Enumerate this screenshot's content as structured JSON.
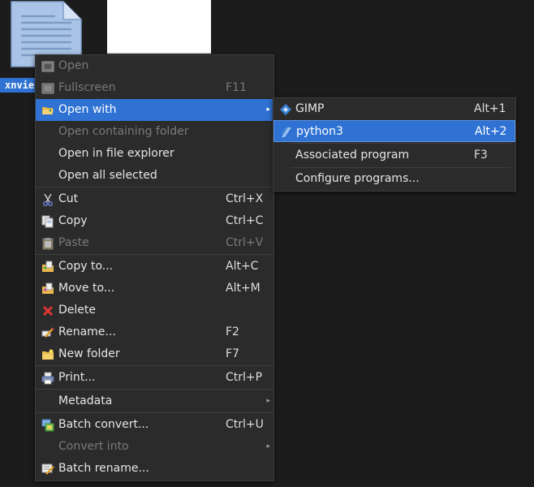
{
  "desktop": {
    "file_label": "xnvie",
    "doc_icon": "document-icon"
  },
  "colors": {
    "menu_bg": "#2b2b2b",
    "highlight": "#2f72d3",
    "disabled_text": "#7a7a7a",
    "text": "#e6e6e6"
  },
  "main_menu": {
    "open": {
      "label": "Open",
      "icon": "open-icon"
    },
    "fullscreen": {
      "label": "Fullscreen",
      "shortcut": "F11",
      "icon": "fullscreen-icon"
    },
    "open_with": {
      "label": "Open with",
      "icon": "folder-open-icon"
    },
    "open_containing": {
      "label": "Open containing folder"
    },
    "open_explorer": {
      "label": "Open in file explorer"
    },
    "open_all": {
      "label": "Open all selected"
    },
    "cut": {
      "label": "Cut",
      "shortcut": "Ctrl+X",
      "icon": "scissors-icon"
    },
    "copy": {
      "label": "Copy",
      "shortcut": "Ctrl+C",
      "icon": "copy-icon"
    },
    "paste": {
      "label": "Paste",
      "shortcut": "Ctrl+V",
      "icon": "paste-icon"
    },
    "copy_to": {
      "label": "Copy to...",
      "shortcut": "Alt+C",
      "icon": "copy-to-icon"
    },
    "move_to": {
      "label": "Move to...",
      "shortcut": "Alt+M",
      "icon": "move-to-icon"
    },
    "delete": {
      "label": "Delete",
      "icon": "delete-icon"
    },
    "rename": {
      "label": "Rename...",
      "shortcut": "F2",
      "icon": "rename-icon"
    },
    "new_folder": {
      "label": "New folder",
      "shortcut": "F7",
      "icon": "new-folder-icon"
    },
    "print": {
      "label": "Print...",
      "shortcut": "Ctrl+P",
      "icon": "printer-icon"
    },
    "metadata": {
      "label": "Metadata"
    },
    "batch_convert": {
      "label": "Batch convert...",
      "shortcut": "Ctrl+U",
      "icon": "batch-convert-icon"
    },
    "convert_into": {
      "label": "Convert into"
    },
    "batch_rename": {
      "label": "Batch rename...",
      "icon": "batch-rename-icon"
    }
  },
  "sub_menu": {
    "gimp": {
      "label": "GIMP",
      "shortcut": "Alt+1",
      "icon": "gimp-icon"
    },
    "python3": {
      "label": "python3",
      "shortcut": "Alt+2",
      "icon": "python-icon"
    },
    "associated": {
      "label": "Associated program",
      "shortcut": "F3"
    },
    "configure": {
      "label": "Configure programs..."
    }
  },
  "arrow_glyph": "▸"
}
